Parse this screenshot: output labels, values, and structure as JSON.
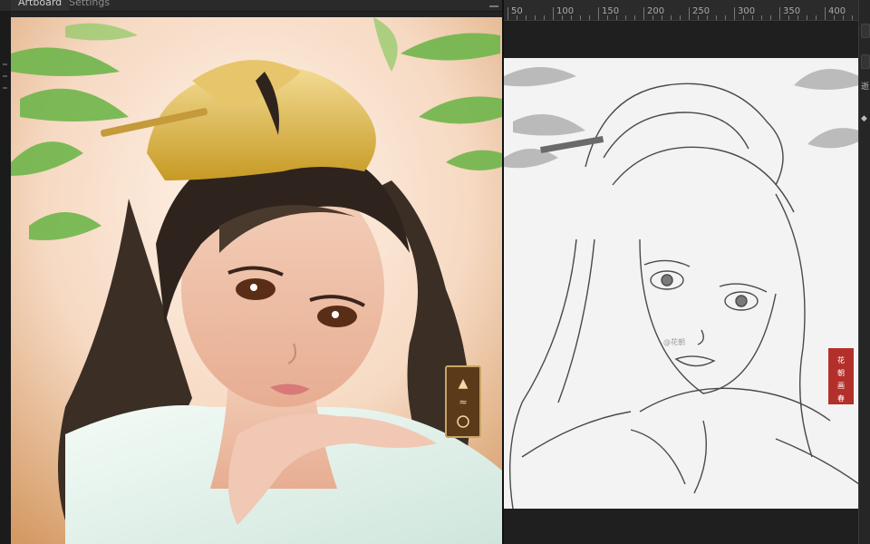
{
  "tabs": [
    {
      "label": "Artboard"
    },
    {
      "label": "Settings"
    }
  ],
  "ruler": {
    "labels": [
      "50",
      "100",
      "150",
      "200",
      "250",
      "300",
      "350",
      "400"
    ]
  },
  "right_strip": {
    "glyph_top": "逝",
    "glyph_bottom": "◆"
  },
  "sketch": {
    "watermark": "@花朝",
    "seal_text": "花朝画春"
  },
  "colors": {
    "bg": "#1f1f1f",
    "panel": "#2b2b2b",
    "ruler_text": "#a9a9a9",
    "seal_red": "#b3302a"
  },
  "icons": {
    "collapse": "minimize-icon",
    "strip_button": "panel-toggle-icon"
  }
}
